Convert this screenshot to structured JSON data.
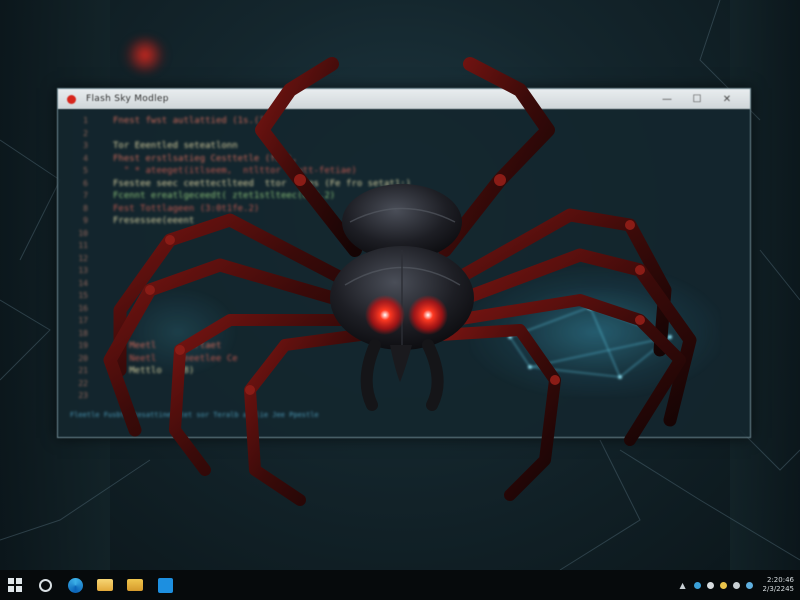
{
  "window": {
    "title": "Flash Sky Modlep",
    "minimize_glyph": "—",
    "maximize_glyph": "☐",
    "close_glyph": "✕"
  },
  "code": {
    "line_numbers": [
      "1",
      "2",
      "3",
      "4",
      "5",
      "6",
      "7",
      "8",
      "9",
      "10",
      "11",
      "12",
      "13",
      "14",
      "15",
      "16",
      "17",
      "18",
      "19",
      "20",
      "21",
      "22",
      "23"
    ],
    "lines": [
      "Fnest fwst autlattied (1s.(?)",
      "       ",
      "Tor Eeentled seteatlonn",
      "Fhest erstlsatieg Cesttetle (fant,",
      "  \" * ateeget(itlseem,  ntlttor  Mutt-fetiae)",
      "Fsestee seec ceettectlteed  ttor  \\tes (Fe fro setat1:)",
      "Fcennt ereatlgeceedt( ztet1stlteec(ee2.2)",
      "Fest Tottlageen (3:0t1fe.2)",
      "Fresessee(eeent",
      "   ",
      "  ",
      "  ",
      "  ",
      "  ",
      "  ",
      "  ",
      "  ",
      "  ",
      "   Meetl     pertaet",
      "   Neetl     eeetlee Ce",
      "   Mettlo   (8)",
      "  ",
      "  "
    ],
    "status_text": "Fleetle Fusbte tesattinet tet sor Teralb attlie Jee Ppestle"
  },
  "taskbar": {
    "clock_time": "2:20:46",
    "clock_date": "2/3/2245"
  },
  "colors": {
    "accent_red": "#d7261c",
    "eye_red": "#ff2a1a",
    "taskbar_bg": "#060a0c"
  }
}
